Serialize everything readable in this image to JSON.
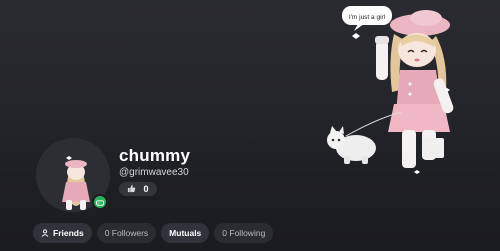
{
  "profile": {
    "display_name": "chummy",
    "username": "@grimwavee30",
    "like_count": "0",
    "status": "online"
  },
  "artwork": {
    "speech_bubble": "I'm just a girl"
  },
  "tabs": [
    {
      "label": "Friends",
      "active": true,
      "icon": "friends-icon"
    },
    {
      "label": "0 Followers",
      "active": false
    },
    {
      "label": "Mutuals",
      "active": false
    },
    {
      "label": "0 Following",
      "active": false
    }
  ],
  "icons": {
    "like": "thumbs-up-icon",
    "status_badge": "game-controller-icon"
  },
  "colors": {
    "background": "#1c1d21",
    "online_green": "#2ab45a",
    "pill": "#33353a"
  }
}
